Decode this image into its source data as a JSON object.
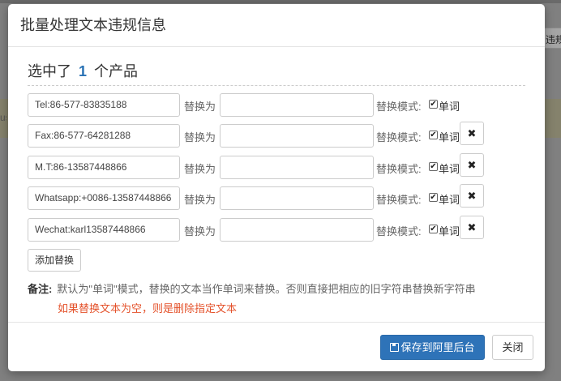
{
  "background": {
    "left_clip_text": "us",
    "right_clip_button": "违规"
  },
  "dialog": {
    "title": "批量处理文本违规信息",
    "selected_prefix": "选中了",
    "selected_count": "1",
    "selected_suffix": "个产品",
    "replace_label": "替换为",
    "mode_label": "替换模式:",
    "word_label": "单词",
    "checkbox_checked": true,
    "rows": [
      {
        "original": "Tel:86-577-83835188",
        "replacement": "",
        "deletable": false
      },
      {
        "original": "Fax:86-577-64281288",
        "replacement": "",
        "deletable": true
      },
      {
        "original": "M.T:86-13587448866",
        "replacement": "",
        "deletable": true
      },
      {
        "original": "Whatsapp:+0086-13587448866",
        "replacement": "",
        "deletable": true
      },
      {
        "original": "Wechat:karl13587448866",
        "replacement": "",
        "deletable": true
      }
    ],
    "add_button": "添加替换",
    "note_label": "备注:",
    "note_text": "默认为\"单词\"模式，替换的文本当作单词来替换。否则直接把相应的旧字符串替换新字符串",
    "note_warning": "如果替换文本为空，则是删除指定文本",
    "save_button": "保存到阿里后台",
    "close_button": "关闭",
    "colors": {
      "primary": "#2e73b8",
      "warning": "#e4522b",
      "count": "#2a72b5"
    }
  }
}
